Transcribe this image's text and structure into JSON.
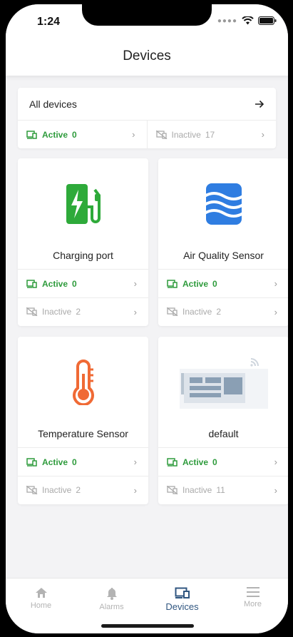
{
  "status_bar": {
    "time": "1:24"
  },
  "header": {
    "title": "Devices"
  },
  "all_devices": {
    "title": "All devices",
    "active_label": "Active",
    "active_count": "0",
    "inactive_label": "Inactive",
    "inactive_count": "17"
  },
  "devices": [
    {
      "name": "Charging port",
      "icon": "charging-station-icon",
      "active_label": "Active",
      "active_count": "0",
      "inactive_label": "Inactive",
      "inactive_count": "2"
    },
    {
      "name": "Air Quality Sensor",
      "icon": "air-quality-icon",
      "active_label": "Active",
      "active_count": "0",
      "inactive_label": "Inactive",
      "inactive_count": "2"
    },
    {
      "name": "Temperature Sensor",
      "icon": "thermometer-icon",
      "active_label": "Active",
      "active_count": "0",
      "inactive_label": "Inactive",
      "inactive_count": "2"
    },
    {
      "name": "default",
      "icon": "device-board-icon",
      "active_label": "Active",
      "active_count": "0",
      "inactive_label": "Inactive",
      "inactive_count": "11"
    }
  ],
  "nav": [
    {
      "label": "Home",
      "icon": "home-icon"
    },
    {
      "label": "Alarms",
      "icon": "bell-icon"
    },
    {
      "label": "Devices",
      "icon": "devices-icon",
      "selected": true
    },
    {
      "label": "More",
      "icon": "menu-icon"
    }
  ],
  "colors": {
    "active": "#2e9b3c",
    "inactive": "#aaaaaa",
    "nav_selected": "#305680",
    "charging": "#2eaa3a",
    "air": "#2f7de1",
    "temp": "#f06a35"
  }
}
